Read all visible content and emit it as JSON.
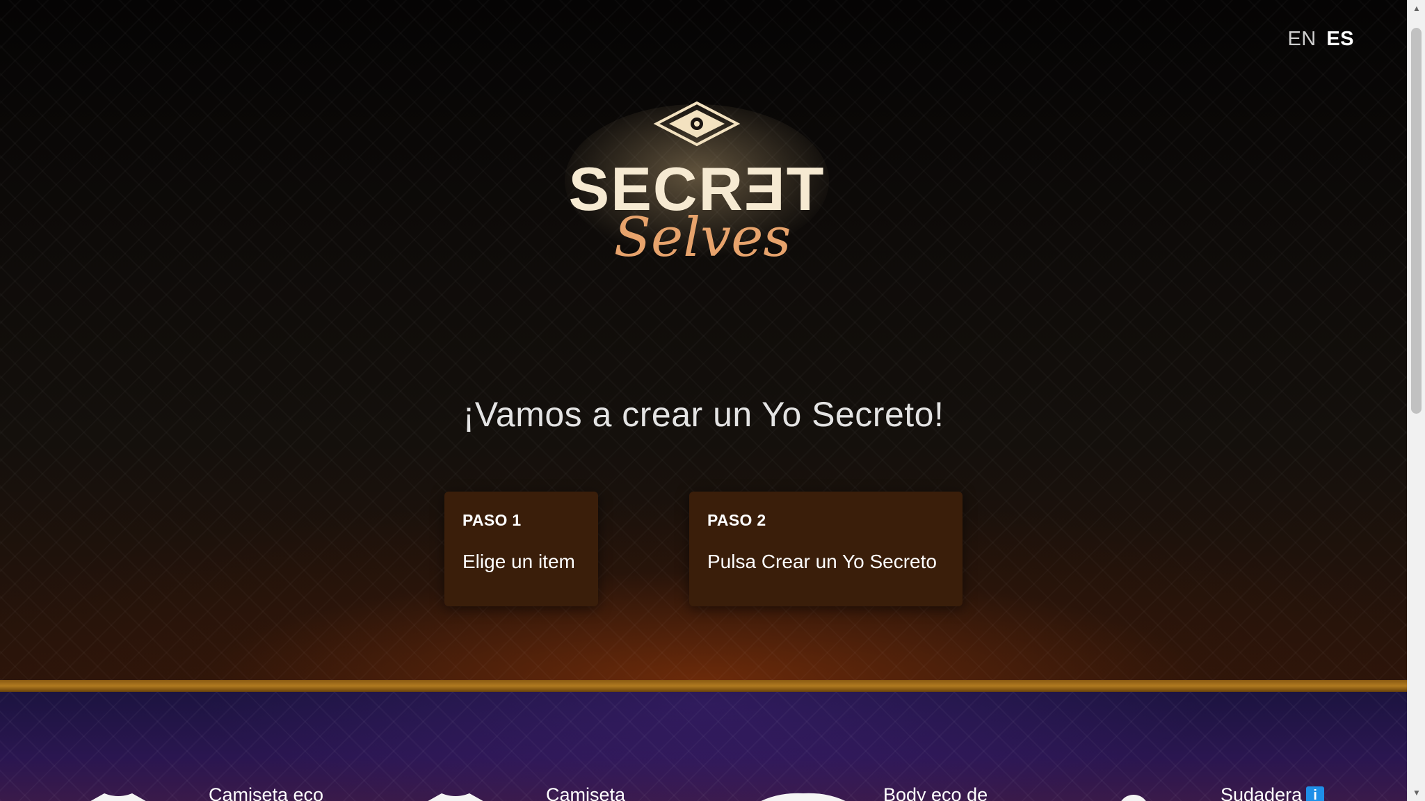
{
  "language_switcher": {
    "en_label": "EN",
    "es_label": "ES",
    "active": "ES"
  },
  "logo": {
    "word_main": "SECRƎT",
    "word_script": "Selves"
  },
  "headline": "¡Vamos a crear un Yo Secreto!",
  "steps": [
    {
      "label": "PASO 1",
      "text": "Elige un item"
    },
    {
      "label": "PASO 2",
      "text": "Pulsa Crear un Yo Secreto"
    }
  ],
  "products": [
    {
      "name": "Camiseta eco",
      "icon": "tshirt-icon"
    },
    {
      "name": "Camiseta",
      "icon": "tshirt-icon"
    },
    {
      "name": "Body eco de",
      "icon": "bodysuit-icon"
    },
    {
      "name": "Sudadera",
      "icon": "hoodie-icon",
      "info_badge": "i"
    }
  ],
  "colors": {
    "step_card_bg": "#3a1e0a",
    "divider_gold": "#b07a20",
    "products_bg": "#2a1650",
    "info_badge": "#1f8fe8",
    "logo_gold": "#f4e6c8",
    "logo_script": "#e7a36c"
  }
}
